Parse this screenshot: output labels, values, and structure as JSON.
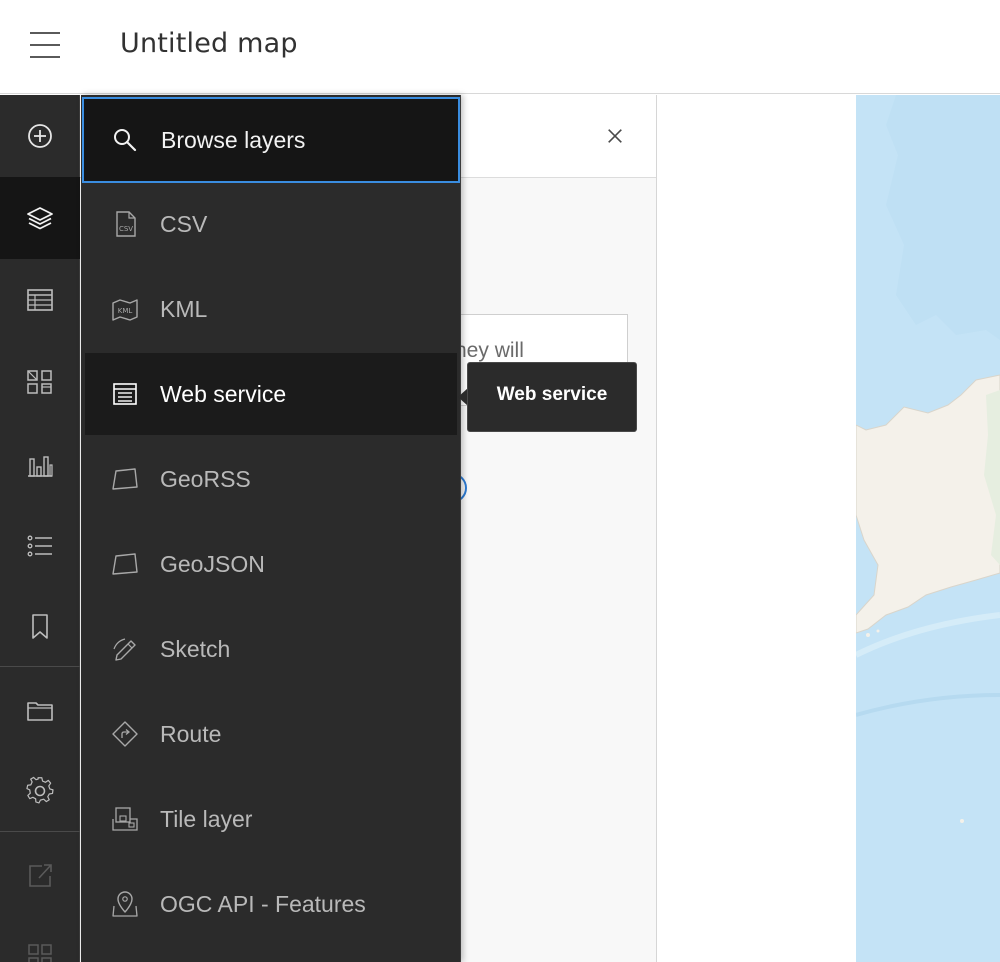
{
  "header": {
    "title": "Untitled map"
  },
  "panel": {
    "partial_text": "hey will"
  },
  "menu": {
    "search_label": "Browse layers",
    "items": [
      {
        "label": "CSV",
        "icon": "csv-file-icon"
      },
      {
        "label": "KML",
        "icon": "kml-map-icon"
      },
      {
        "label": "Web service",
        "icon": "web-service-icon",
        "hovered": true
      },
      {
        "label": "GeoRSS",
        "icon": "map-sheet-icon"
      },
      {
        "label": "GeoJSON",
        "icon": "map-sheet-icon"
      },
      {
        "label": "Sketch",
        "icon": "pencil-icon"
      },
      {
        "label": "Route",
        "icon": "route-sign-icon"
      },
      {
        "label": "Tile layer",
        "icon": "tile-layer-icon"
      },
      {
        "label": "OGC API - Features",
        "icon": "map-pin-icon"
      }
    ]
  },
  "tooltip": {
    "text": "Web service"
  },
  "rail": {
    "icons": [
      "add-circle-icon",
      "layers-icon",
      "table-icon",
      "legend-icon",
      "chart-icon",
      "list-icon",
      "bookmark-icon",
      "folder-icon",
      "gear-icon",
      "share-icon",
      "apps-grid-icon"
    ]
  },
  "colors": {
    "focus_ring": "#3a8de0",
    "menu_bg": "#2b2b2b",
    "map_water": "#c4e3f6"
  }
}
